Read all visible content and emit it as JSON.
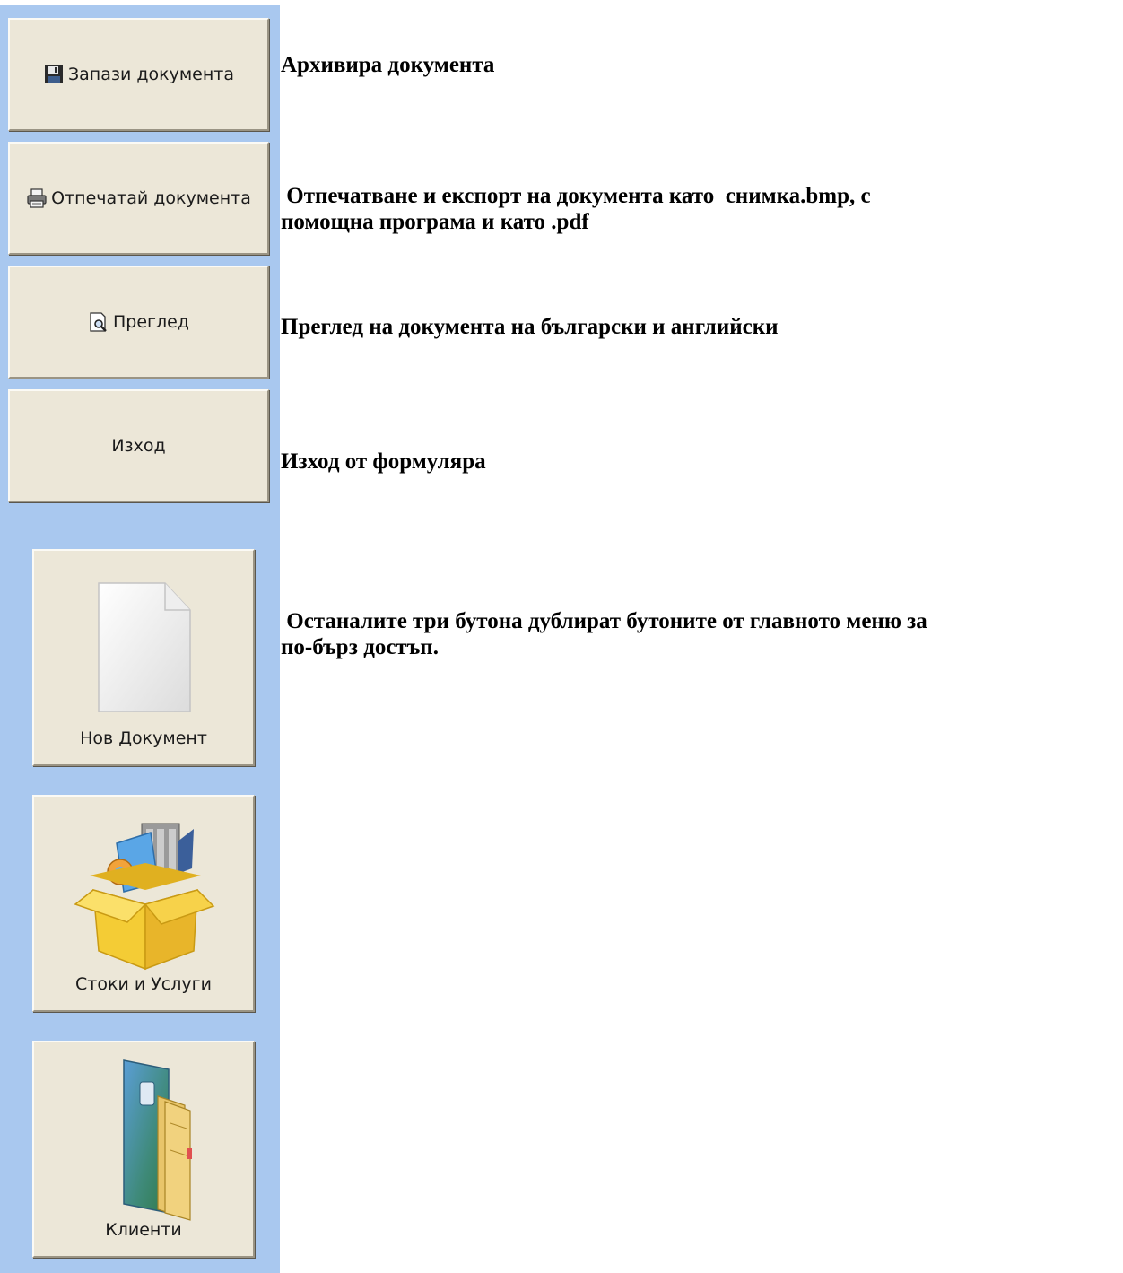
{
  "buttons": {
    "save_label": "Запази документа",
    "print_label": "Отпечатай документа",
    "preview_label": "Преглед",
    "exit_label": "Изход",
    "new_document_label": "Нов Документ",
    "goods_services_label": "Стоки и Услуги",
    "clients_label": "Клиенти"
  },
  "descriptions": {
    "save": "Архивира документа",
    "print_line1": " Отпечатване и експорт на документа като  снимка.bmp, с",
    "print_line2": "помощна програма и като .pdf",
    "preview": "Преглед на документа на български и английски",
    "exit": "Изход от формуляра",
    "shortcuts_line1": " Останалите три бутона дублират бутоните от главното меню за",
    "shortcuts_line2": "по-бърз достъп."
  },
  "icons": {
    "save": "floppy-disk-icon",
    "print": "printer-icon",
    "preview": "print-preview-icon",
    "new_document": "blank-document-icon",
    "goods_services": "open-box-icon",
    "clients": "folder-icon"
  },
  "colors": {
    "sidebar_background": "#a9c8ef",
    "button_face": "#ece7d8"
  }
}
